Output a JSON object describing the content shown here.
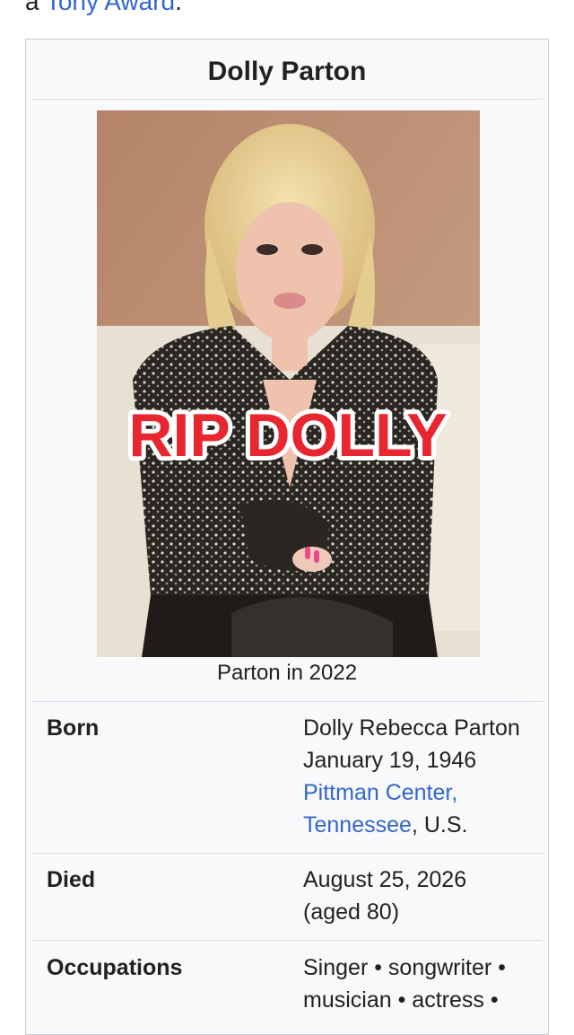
{
  "intro": {
    "prefix": "a ",
    "link": "Tony Award",
    "suffix": "."
  },
  "infobox": {
    "title": "Dolly Parton",
    "image": {
      "overlay_text": "RIP DOLLY",
      "caption": "Parton in 2022"
    },
    "born": {
      "label": "Born",
      "name": "Dolly Rebecca Parton",
      "date": "January 19, 1946",
      "place_link_1": "Pittman Center,",
      "place_link_2": "Tennessee",
      "place_suffix": ", U.S."
    },
    "died": {
      "label": "Died",
      "date": "August 25, 2026",
      "age": "(aged 80)"
    },
    "occupations": {
      "label": "Occupations",
      "line1": "Singer • songwriter •",
      "line2": "musician • actress •"
    }
  },
  "colors": {
    "link": "#3366cc",
    "infobox_bg": "#f8f9fa",
    "infobox_border": "#c8ccd1",
    "overlay_text": "#e8262f"
  }
}
